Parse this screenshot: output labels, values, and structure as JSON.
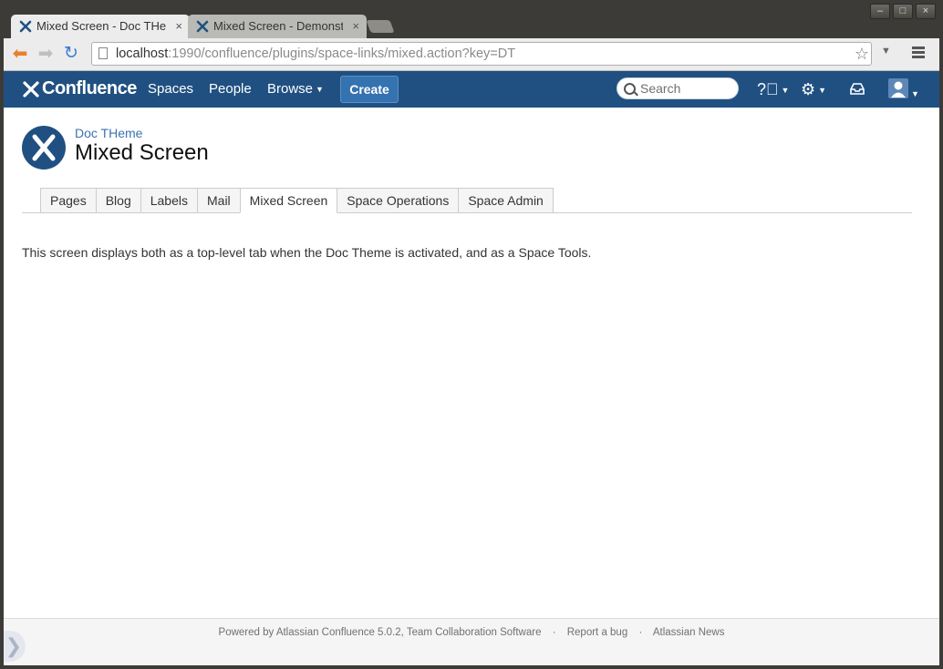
{
  "browser": {
    "tabs": [
      {
        "title": "Mixed Screen - Doc THeme",
        "close": "×"
      },
      {
        "title": "Mixed Screen - Demonstration",
        "close": "×"
      }
    ],
    "window_buttons": {
      "minimize": "–",
      "maximize": "□",
      "close": "×"
    },
    "url_host": "localhost",
    "url_rest": ":1990/confluence/plugins/space-links/mixed.action?key=DT"
  },
  "header": {
    "logo_text": "Confluence",
    "nav": {
      "spaces": "Spaces",
      "people": "People",
      "browse": "Browse"
    },
    "create_label": "Create",
    "search_placeholder": "Search"
  },
  "page": {
    "space_name": "Doc THeme",
    "title": "Mixed Screen",
    "tabs": [
      "Pages",
      "Blog",
      "Labels",
      "Mail",
      "Mixed Screen",
      "Space Operations",
      "Space Admin"
    ],
    "active_tab": "Mixed Screen",
    "body_text": "This screen displays both as a top-level tab when the Doc Theme is activated, and as a Space Tools."
  },
  "footer": {
    "powered_by": "Powered by Atlassian Confluence 5.0.2, Team Collaboration Software",
    "report_bug": "Report a bug",
    "news": "Atlassian News",
    "separator": "·"
  },
  "colors": {
    "header_bg": "#205081",
    "link": "#3b73af",
    "create_btn": "#3572b0"
  }
}
